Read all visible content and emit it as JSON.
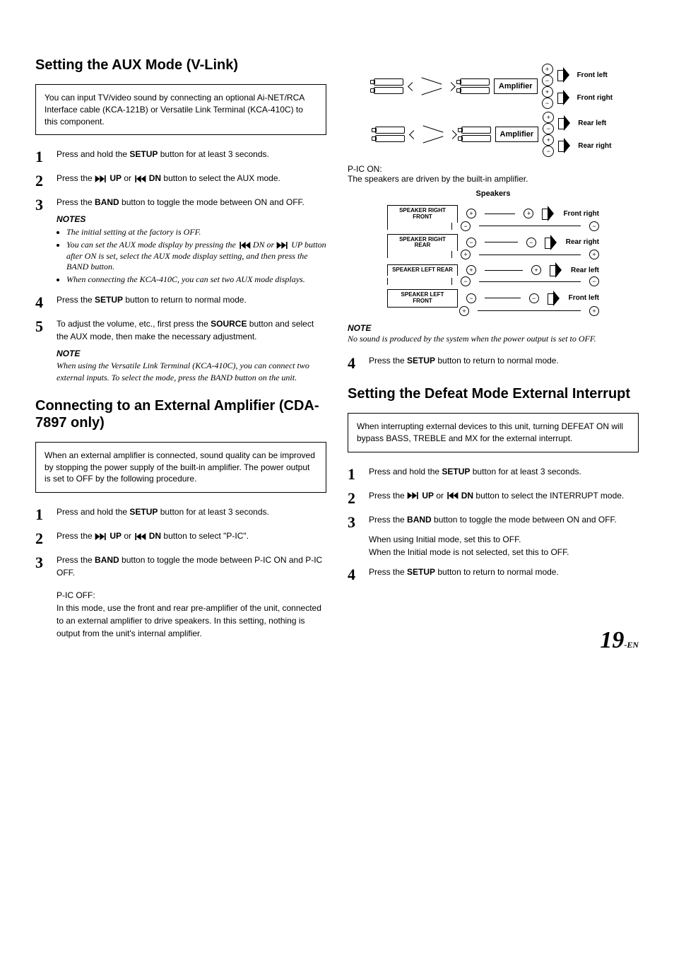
{
  "page": {
    "num": "19",
    "suffix": "-EN"
  },
  "secA": {
    "title": "Setting the AUX Mode (V-Link)",
    "intro": "You can input TV/video sound by connecting an optional Ai-NET/RCA Interface cable (KCA-121B) or Versatile Link Terminal (KCA-410C) to this component.",
    "s1a": "Press and hold the ",
    "s1b": "SETUP",
    "s1c": " button for at least 3 seconds.",
    "s2a": "Press the ",
    "s2b": " UP",
    "s2c": " or ",
    "s2d": " DN",
    "s2e": " button to select the AUX mode.",
    "s3a": "Press the ",
    "s3b": "BAND",
    "s3c": " button to toggle the mode between ON and OFF.",
    "notesHd": "NOTES",
    "n1": "The initial setting at the factory is OFF.",
    "n2a": "You can set the AUX mode display by pressing the ",
    "n2b": " DN or ",
    "n2c": " UP button after ON is set, select the AUX mode display setting, and then press the BAND button.",
    "n3": "When connecting the KCA-410C, you can set two AUX mode displays.",
    "s4a": "Press the ",
    "s4b": "SETUP",
    "s4c": " button to return to normal mode.",
    "s5a": "To adjust the volume, etc., first press the ",
    "s5b": "SOURCE",
    "s5c": " button and select the AUX mode, then make the necessary adjustment.",
    "noteHd": "NOTE",
    "noteP": "When using the Versatile Link Terminal (KCA-410C), you can connect two external inputs. To select the mode, press the BAND button on the unit."
  },
  "secB": {
    "title": "Connecting to an External Amplifier (CDA-7897 only)",
    "intro": "When an external amplifier is connected, sound quality can be improved by stopping the power supply of the built-in amplifier. The power output is set to OFF by the following procedure.",
    "s1a": "Press and hold the ",
    "s1b": "SETUP",
    "s1c": " button for at least 3 seconds.",
    "s2a": "Press the ",
    "s2b": " UP",
    "s2c": " or ",
    "s2d": " DN",
    "s2e": " button to select \"P-IC\".",
    "s3a": "Press the ",
    "s3b": "BAND",
    "s3c": " button to toggle the mode between P-IC ON and P-IC OFF.",
    "picoffHd": "P-IC OFF:",
    "picoff": "In this mode, use the front and rear pre-amplifier of the unit, connected to an external amplifier to drive speakers. In this setting, nothing is output from the unit's internal amplifier.",
    "piconHd": "P-IC ON:",
    "picon": "The speakers are driven by the built-in amplifier.",
    "spkTitle": "Speakers",
    "diag1": {
      "amp": "Amplifier",
      "fl": "Front left",
      "fr": "Front right",
      "rl": "Rear left",
      "rr": "Rear right"
    },
    "diag2": {
      "srf": "SPEAKER RIGHT FRONT",
      "srr": "SPEAKER RIGHT REAR",
      "slr": "SPEAKER LEFT REAR",
      "slf": "SPEAKER LEFT FRONT",
      "fr": "Front right",
      "rr": "Rear right",
      "rl": "Rear left",
      "fl": "Front left"
    },
    "noteHd": "NOTE",
    "noteP": "No sound is produced by the system when the power output is set to OFF.",
    "s4a": "Press the ",
    "s4b": "SETUP",
    "s4c": " button to return to normal mode."
  },
  "secC": {
    "title": "Setting the Defeat Mode External Interrupt",
    "intro": "When interrupting external devices to this unit, turning DEFEAT ON will bypass BASS, TREBLE and MX for the external interrupt.",
    "s1a": "Press and hold the ",
    "s1b": "SETUP",
    "s1c": " button for at least 3 seconds.",
    "s2a": "Press the ",
    "s2b": " UP",
    "s2c": " or ",
    "s2d": " DN",
    "s2e": " button to select the INTERRUPT mode.",
    "s3a": "Press the ",
    "s3b": "BAND",
    "s3c": " button to toggle the mode between ON and OFF.",
    "s3x1": "When using Initial mode, set this to OFF.",
    "s3x2": "When the Initial mode is not selected, set this to OFF.",
    "s4a": "Press the ",
    "s4b": "SETUP",
    "s4c": " button to return to normal mode."
  }
}
